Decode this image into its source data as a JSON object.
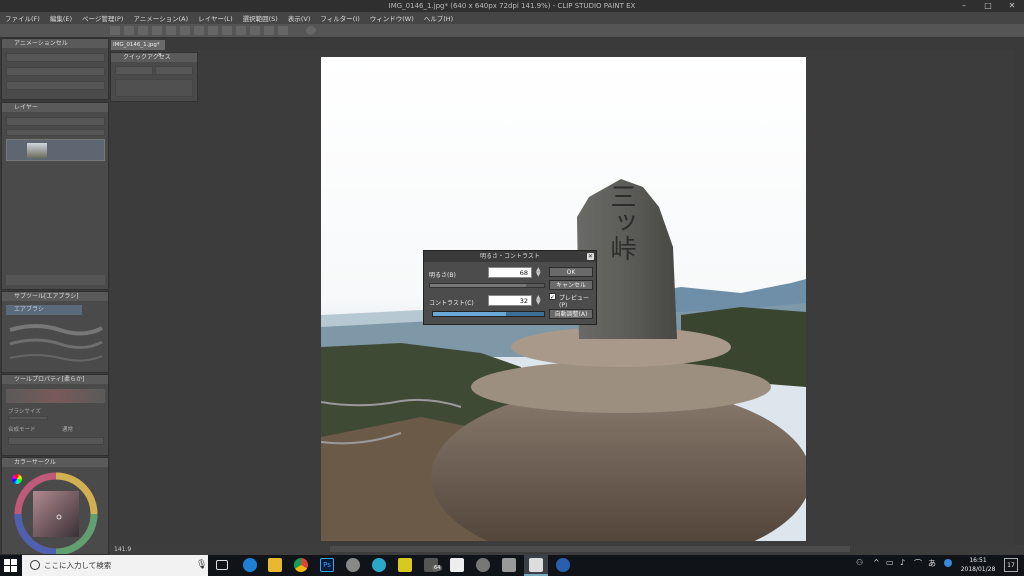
{
  "window": {
    "title": "IMG_0146_1.jpg* (640 x 640px 72dpi 141.9%) - CLIP STUDIO PAINT EX"
  },
  "menu": [
    "ファイル(F)",
    "編集(E)",
    "ページ管理(P)",
    "アニメーション(A)",
    "レイヤー(L)",
    "選択範囲(S)",
    "表示(V)",
    "フィルター(I)",
    "ウィンドウ(W)",
    "ヘルプ(H)"
  ],
  "document_tab": {
    "label": "IMG_0146_1.jpg*",
    "close": "×"
  },
  "panels": {
    "animation_cel": "アニメーションセル",
    "quick_access": "クイックアクセス",
    "layer": "レイヤー",
    "subtool": "サブツール[エアブラシ]",
    "subtool_item": "エアブラシ",
    "tool_property": "ツールプロパティ[柔らか]",
    "brush_size_label": "ブラシサイズ",
    "blend_mode_label": "合成モード",
    "blend_mode_value": "通常",
    "color_circle": "カラーサークル"
  },
  "dialog": {
    "title": "明るさ・コントラスト",
    "brightness_label": "明るさ(B)",
    "brightness_value": "68",
    "contrast_label": "コントラスト(C)",
    "contrast_value": "32",
    "brightness_level": 0.84,
    "contrast_level": 0.66,
    "ok": "OK",
    "cancel": "キャンセル",
    "preview": "プレビュー(P)",
    "preview_checked": true,
    "auto": "自動調整(A)"
  },
  "monument_text": "三ッ峠",
  "status": {
    "zoom": "141.9"
  },
  "taskbar": {
    "search_placeholder": "ここに入力して検索",
    "time": "16:51",
    "date": "2018/01/28",
    "notification_count": "17",
    "badge": "64"
  },
  "colors": {
    "accent": "#5aa0d8",
    "taskbar": "#101419",
    "ui_bg": "#3c3c3c"
  }
}
